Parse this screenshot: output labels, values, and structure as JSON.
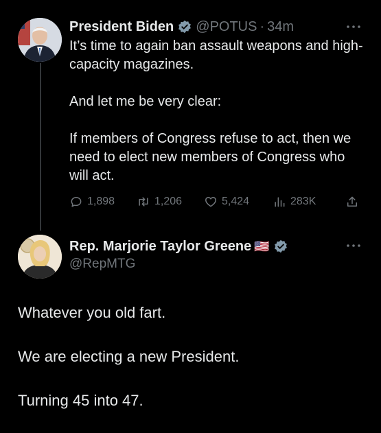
{
  "tweet1": {
    "name": "President Biden",
    "handle": "@POTUS",
    "separator": "·",
    "time": "34m",
    "text": "It’s time to again ban assault weapons and high-capacity magazines.\n\nAnd let me be very clear:\n\nIf members of Congress refuse to act, then we need to elect new members of Congress who will act.",
    "stats": {
      "replies": "1,898",
      "retweets": "1,206",
      "likes": "5,424",
      "views": "283K"
    }
  },
  "tweet2": {
    "name": "Rep. Marjorie Taylor Greene",
    "flag": "🇺🇸",
    "handle": "@RepMTG",
    "text": "Whatever you old fart.\n\nWe are electing a new President.\n\nTurning 45 into 47."
  },
  "colors": {
    "background": "#000000",
    "text": "#e7e9ea",
    "muted": "#71767b",
    "verified_biden": "#829aab",
    "verified_mtg": "#829aab"
  }
}
